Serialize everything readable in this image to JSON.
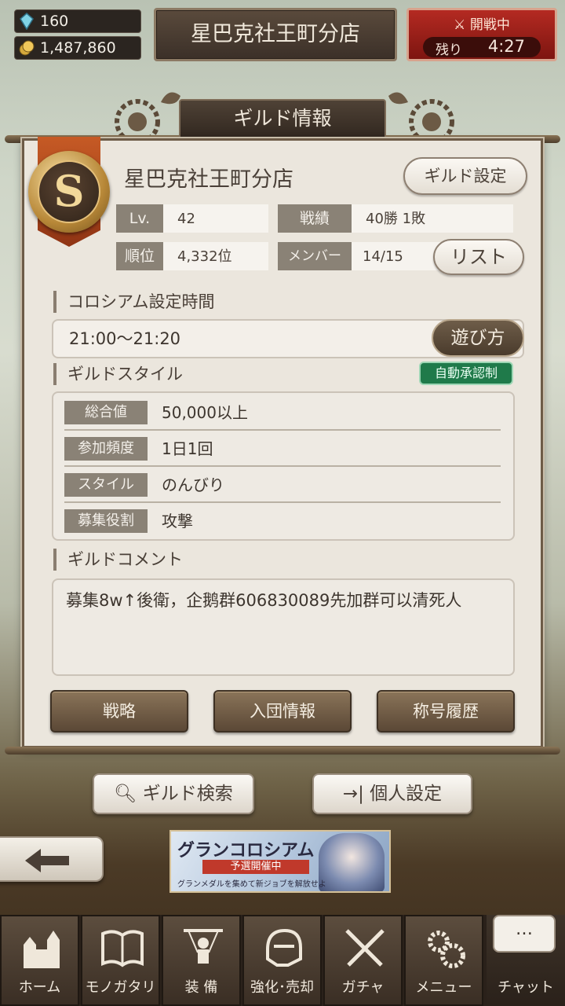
{
  "status": {
    "gems": "160",
    "coins": "1,487,860",
    "shop_name": "星巴克社王町分店",
    "battle_label": "開戦中",
    "remaining_label": "残り",
    "remaining_time": "4:27"
  },
  "panel": {
    "title": "ギルド情報",
    "emblem_letter": "S",
    "guild_name": "星巴克社王町分店",
    "settings_button": "ギルド設定",
    "stats": {
      "level_label": "Lv.",
      "level_value": "42",
      "record_label": "戦績",
      "record_value": "40勝 1敗",
      "rank_label": "順位",
      "rank_value": "4,332位",
      "members_label": "メンバー",
      "members_value": "14/15"
    },
    "list_button": "リスト",
    "colosseum_heading": "コロシアム設定時間",
    "colosseum_time": "21:00〜21:20",
    "howto_button": "遊び方",
    "style_heading": "ギルドスタイル",
    "auto_badge": "自動承認制",
    "style_rows": [
      {
        "label": "総合値",
        "value": "50,000以上"
      },
      {
        "label": "参加頻度",
        "value": "1日1回"
      },
      {
        "label": "スタイル",
        "value": "のんびり"
      },
      {
        "label": "募集役割",
        "value": "攻撃"
      }
    ],
    "comment_heading": "ギルドコメント",
    "comment": "募集8w↑後衛，企鹅群606830089先加群可以清死人",
    "actions": [
      "戦略",
      "入団情報",
      "称号履歴"
    ]
  },
  "lower": {
    "search_button": "ギルド検索",
    "personal_button": "個人設定",
    "banner_title": "グランコロシアム",
    "banner_sub": "予選開催中",
    "banner_note": "グランメダルを集めて新ジョブを解放せよ"
  },
  "nav": {
    "items": [
      "ホーム",
      "モノガタリ",
      "装 備",
      "強化･売却",
      "ガチャ",
      "メニュー"
    ],
    "chat_label": "チャット",
    "chat_bubble": "…"
  }
}
